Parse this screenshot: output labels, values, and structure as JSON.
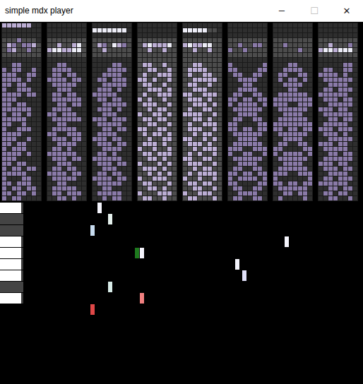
{
  "window": {
    "title": "simple mdx player",
    "controls": [
      "─",
      "☐",
      "✕"
    ]
  },
  "channels": [
    {
      "cells": [
        "33333300",
        "00000000",
        "00000000",
        "11121110",
        "13212231",
        "12311211",
        "11111111",
        "00000000",
        "00220000",
        "20220020",
        "22200220",
        "22220200",
        "22022000",
        "20022200",
        "22220220",
        "22200000",
        "22022000",
        "22222200",
        "20220200",
        "22222000",
        "22002000",
        "20022200",
        "22220000",
        "22200200",
        "22022000",
        "20222000",
        "22220200",
        "22200000",
        "22022000",
        "20220220",
        "22222000",
        "20002200",
        "22022200",
        "20220220",
        "22022020",
        "20220000"
      ]
    },
    {
      "cells": [
        "00000000",
        "00000000",
        "00000000",
        "11111111",
        "11311341",
        "34433441",
        "11111111",
        "00000000",
        "00220000",
        "02222000",
        "02202200",
        "22220220",
        "02222200",
        "00222000",
        "02202200",
        "02222220",
        "00220220",
        "02222000",
        "22022200",
        "02222220",
        "00220000",
        "02222200",
        "22002220",
        "02220220",
        "00222200",
        "02202000",
        "22222200",
        "02220220",
        "00222000",
        "02202200",
        "22220220",
        "02222200",
        "00220000",
        "02222200",
        "02202220",
        "00220200"
      ]
    },
    {
      "cells": [
        "00000000",
        "44444440",
        "00000000",
        "11111111",
        "13214321",
        "11311111",
        "11111111",
        "00000000",
        "00002200",
        "00022220",
        "00222200",
        "02202220",
        "00222220",
        "02220200",
        "22222000",
        "02202200",
        "00222220",
        "02220200",
        "00222000",
        "22202220",
        "02222200",
        "00220220",
        "02222000",
        "22202200",
        "02220220",
        "00222200",
        "02202000",
        "22222200",
        "02220220",
        "00222000",
        "02202200",
        "22220220",
        "02222200",
        "00220000",
        "02222200",
        "00202200"
      ]
    },
    {
      "cells": [
        "00000000",
        "00000000",
        "00000000",
        "11111111",
        "13433341",
        "11311311",
        "11111111",
        "11111111",
        "13311311",
        "11331131",
        "13113331",
        "33131131",
        "13311311",
        "11333131",
        "13113331",
        "31311311",
        "13331131",
        "11313311",
        "31133131",
        "13313311",
        "11331131",
        "33113311",
        "13133131",
        "11311331",
        "13331311",
        "31131131",
        "13313331",
        "11331311",
        "31113131",
        "13331311",
        "11313131",
        "31133311",
        "13311131",
        "11331311",
        "31113331",
        "13311311"
      ]
    },
    {
      "cells": [
        "00000000",
        "44444110",
        "00000000",
        "11111111",
        "34334411",
        "11311311",
        "11111111",
        "11111111",
        "11331111",
        "13333111",
        "13113311",
        "11333331",
        "13311311",
        "11333111",
        "33113331",
        "13331311",
        "11333131",
        "13113311",
        "33331131",
        "11331311",
        "13113331",
        "13331131",
        "11313311",
        "33113131",
        "13331311",
        "11313331",
        "13131131",
        "33113311",
        "13331131",
        "11313311",
        "13133331",
        "31131131",
        "13313311",
        "11331131",
        "31133311",
        "13311131"
      ]
    },
    {
      "cells": [
        "00000000",
        "00000000",
        "00000000",
        "11111111",
        "11211221",
        "21121111",
        "11111111",
        "00000000",
        "20000002",
        "22000022",
        "02200220",
        "00222200",
        "00022000",
        "00222200",
        "02200220",
        "22022022",
        "20222202",
        "02222220",
        "00222200",
        "02200220",
        "22000022",
        "22022022",
        "02222220",
        "00222200",
        "02222220",
        "22200222",
        "20022002",
        "02222220",
        "00222200",
        "02200220",
        "22022022",
        "20222202",
        "22000022",
        "02200220",
        "00222200",
        "02200220"
      ]
    },
    {
      "cells": [
        "00000000",
        "00000000",
        "00000000",
        "11111111",
        "11211111",
        "11111211",
        "11111111",
        "00000000",
        "00022000",
        "00222200",
        "02200220",
        "02022020",
        "00222200",
        "00022000",
        "02222220",
        "22222222",
        "22200222",
        "02222220",
        "00222200",
        "02222220",
        "22222222",
        "22022022",
        "02222220",
        "00222200",
        "02200220",
        "22000022",
        "20222202",
        "02222220",
        "00222200",
        "02222220",
        "22200222",
        "20000002",
        "22022022",
        "02222220",
        "00220220",
        "02000020"
      ]
    },
    {
      "cells": [
        "00000000",
        "00000000",
        "00000000",
        "11111111",
        "11311121",
        "34434441",
        "11111111",
        "00000000",
        "00000220",
        "02200220",
        "22220200",
        "02222220",
        "00222200",
        "02202220",
        "22222200",
        "02220220",
        "00222220",
        "22202200",
        "02222220",
        "00220220",
        "02222200",
        "22202220",
        "02220200",
        "00222220",
        "22202200",
        "02222200",
        "00220220",
        "02222220",
        "22202200",
        "02220220",
        "00222200",
        "02202220",
        "22222200",
        "00220220",
        "02202200",
        "00220020"
      ]
    }
  ],
  "keyboard": {
    "keys": [
      {
        "kind": "white"
      },
      {
        "kind": "black"
      },
      {
        "kind": "black"
      },
      {
        "kind": "white"
      },
      {
        "kind": "white"
      },
      {
        "kind": "white"
      },
      {
        "kind": "white"
      },
      {
        "kind": "black"
      },
      {
        "kind": "white"
      }
    ]
  },
  "notes": [
    {
      "key": 0,
      "time": 138,
      "color": "#f4f4fc"
    },
    {
      "key": 1,
      "time": 153,
      "color": "#e4f0ec"
    },
    {
      "key": 2,
      "time": 128,
      "color": "#c8dcf0"
    },
    {
      "key": 3,
      "time": 403,
      "color": "#f4f4fc"
    },
    {
      "key": 4,
      "time": 191,
      "color": "#1e7a1e"
    },
    {
      "key": 4,
      "time": 198,
      "color": "#f4f4fc"
    },
    {
      "key": 5,
      "time": 333,
      "color": "#f4f4fc"
    },
    {
      "key": 6,
      "time": 343,
      "color": "#e0e0f8"
    },
    {
      "key": 7,
      "time": 153,
      "color": "#d8ece8"
    },
    {
      "key": 8,
      "time": 198,
      "color": "#f08080"
    },
    {
      "key": 9,
      "time": 128,
      "color": "#e04848"
    }
  ]
}
